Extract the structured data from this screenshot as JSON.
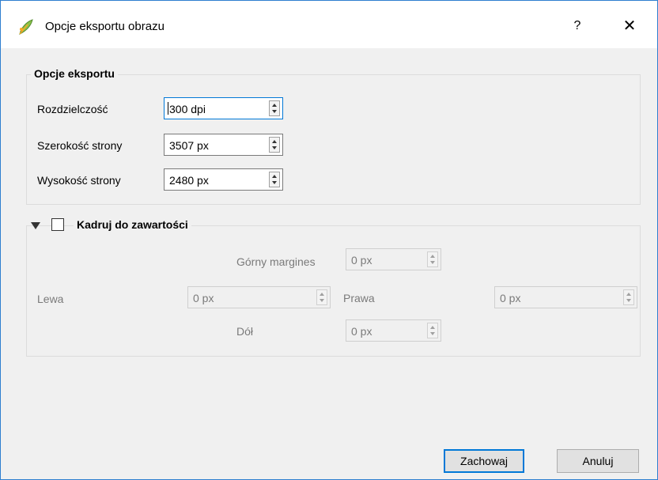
{
  "window": {
    "title": "Opcje eksportu obrazu",
    "help_label": "?",
    "close_label": "✕"
  },
  "export_options": {
    "group_title": "Opcje eksportu",
    "resolution": {
      "label": "Rozdzielczość",
      "value": "300 dpi"
    },
    "page_width": {
      "label": "Szerokość strony",
      "value": "3507 px"
    },
    "page_height": {
      "label": "Wysokość strony",
      "value": "2480 px"
    }
  },
  "crop": {
    "title": "Kadruj do zawartości",
    "checked": false,
    "top": {
      "label": "Górny margines",
      "value": "0 px"
    },
    "left": {
      "label": "Lewa",
      "value": "0 px"
    },
    "right": {
      "label": "Prawa",
      "value": "0 px"
    },
    "bottom": {
      "label": "Dół",
      "value": "0 px"
    }
  },
  "buttons": {
    "save": "Zachowaj",
    "cancel": "Anuluj"
  },
  "colors": {
    "accent": "#0078d7",
    "window_border": "#2f7fd0",
    "icon_green": "#7cb342"
  }
}
